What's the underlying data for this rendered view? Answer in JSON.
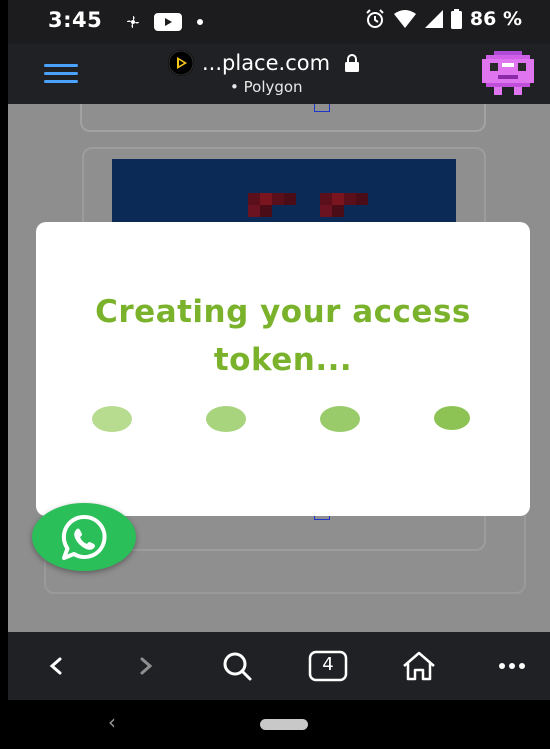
{
  "status_bar": {
    "time": "3:45",
    "battery_percent": "86 %",
    "left_icons": [
      "fan-icon",
      "youtube-icon",
      "notification-dot-icon"
    ],
    "right_icons": [
      "alarm-icon",
      "wifi-icon",
      "signal-icon",
      "battery-icon"
    ]
  },
  "browser": {
    "url": "...place.com",
    "network": "Polygon",
    "site_icon": "play-logo-icon",
    "lock_icon": "lock-icon",
    "avatar": "pixel-avatar-icon"
  },
  "modal": {
    "title": "Creating your access token...",
    "dots_count": 4
  },
  "fab": {
    "icon": "whatsapp-icon"
  },
  "bottom_nav": {
    "tab_count": "4",
    "items": [
      "back-icon",
      "forward-icon",
      "search-icon",
      "tabs-icon",
      "home-icon",
      "more-icon"
    ]
  },
  "colors": {
    "accent_green": "#7ab32b",
    "whatsapp_green": "#2bbf5a",
    "header_bg": "#202124",
    "nft_blue": "#0b2a55"
  }
}
